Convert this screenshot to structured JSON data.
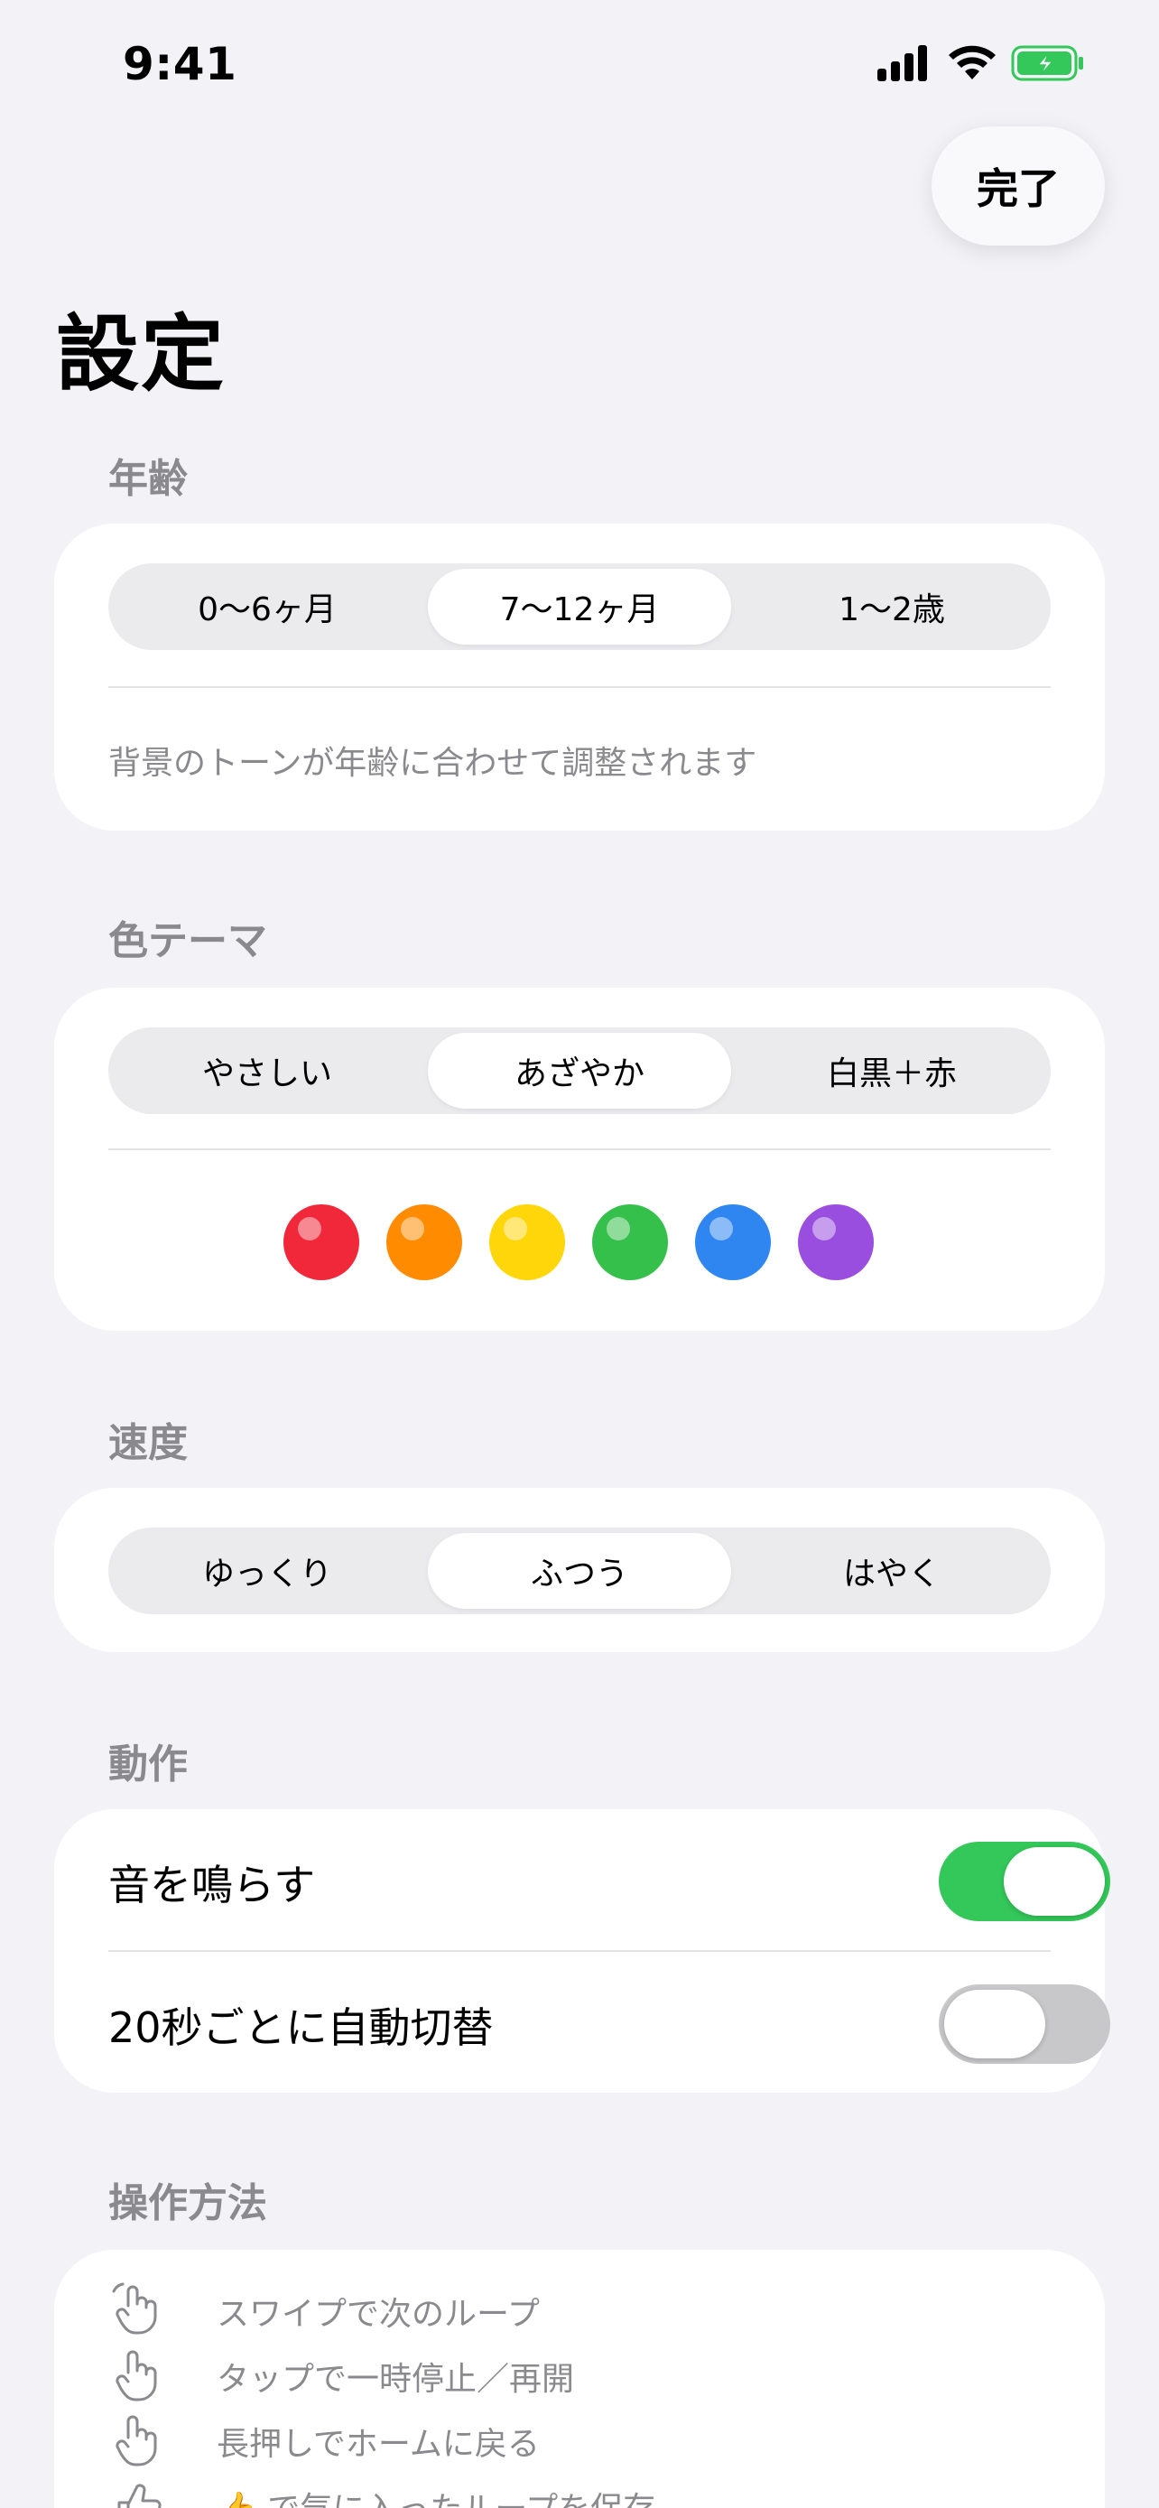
{
  "status_bar": {
    "time": "9:41"
  },
  "header": {
    "done_label": "完了",
    "title": "設定"
  },
  "age": {
    "section_title": "年齢",
    "options": [
      "0〜6ヶ月",
      "7〜12ヶ月",
      "1〜2歳"
    ],
    "selected": "7〜12ヶ月",
    "hint": "背景のトーンが年齢に合わせて調整されます"
  },
  "theme": {
    "section_title": "色テーマ",
    "options": [
      "やさしい",
      "あざやか",
      "白黒＋赤"
    ],
    "selected": "あざやか",
    "swatches": [
      "#f0283a",
      "#ff8c00",
      "#ffd60a",
      "#34c04a",
      "#2f86f0",
      "#9a4ee0"
    ]
  },
  "speed": {
    "section_title": "速度",
    "options": [
      "ゆっくり",
      "ふつう",
      "はやく"
    ],
    "selected": "ふつう"
  },
  "behavior": {
    "section_title": "動作",
    "sound_label": "音を鳴らす",
    "sound_on": true,
    "auto_switch_label": "20秒ごとに自動切替",
    "auto_switch_on": false
  },
  "howto": {
    "section_title": "操作方法",
    "items": [
      {
        "icon": "swipe-hand-icon",
        "text": "スワイプで次のループ"
      },
      {
        "icon": "tap-hand-icon",
        "text": "タップで一時停止／再開"
      },
      {
        "icon": "long-press-hand-icon",
        "text": "長押しでホームに戻る"
      },
      {
        "icon": "thumbs-up-icon",
        "text": "👍 で気に入ったループを保存"
      }
    ]
  },
  "colors": {
    "accent_green": "#34c759",
    "secondary_text": "#8a8a8e",
    "background": "#f2f2f7"
  }
}
